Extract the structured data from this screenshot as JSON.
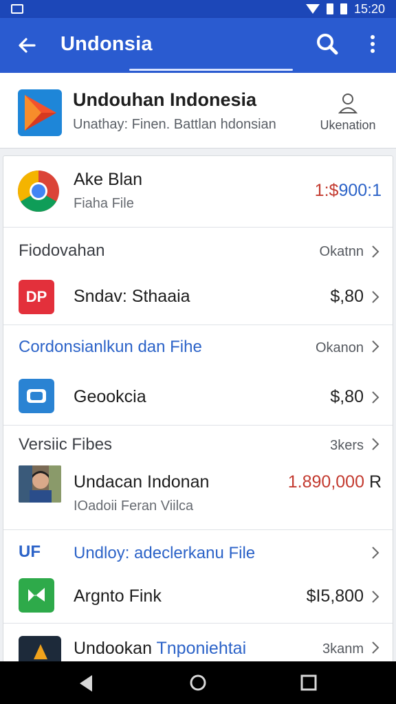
{
  "status_bar": {
    "time": "15:20"
  },
  "app_bar": {
    "title": "Undonsia"
  },
  "header": {
    "title": "Undouhan Indonesia",
    "subtitle": "Unathay: Finen. Battlan hdonsian",
    "account_label": "Ukenation"
  },
  "rows": {
    "app1": {
      "label": "Ake Blan",
      "sub": "Fiaha File",
      "value_red": "1:$",
      "value_blue": "900:1"
    },
    "section1": {
      "title": "Fiodovahan",
      "right": "Okatnn"
    },
    "app2": {
      "icon_text": "DP",
      "label": "Sndav: Sthaaia",
      "value": "$,80"
    },
    "section2": {
      "title": "Cordonsianlkun dan Fihe",
      "right": "Okanon"
    },
    "app3": {
      "label": "Geookcia",
      "value": "$,80"
    },
    "section3": {
      "title": "Versiic Fibes",
      "right": "3kers"
    },
    "app4": {
      "label": "Undacan Indonan",
      "sub": "IOadoii Feran Viilca",
      "value_red": "1.890,000",
      "value_suffix": "R"
    },
    "section4": {
      "icon_text": "UF",
      "title": "Undloy: adeclerkanu File"
    },
    "app5": {
      "label": "Argnto Fink",
      "value": "$I5,800"
    },
    "app6": {
      "label_a": "Undookan",
      "label_b": "Tnponiehtai",
      "right": "3kanm"
    }
  },
  "colors": {
    "app_bar": "#2a5bd0",
    "status_bar": "#1c47b8",
    "accent_blue": "#2c63c8",
    "price_red": "#c33a2f"
  },
  "icons": {
    "back": "arrow-left-icon",
    "search": "search-icon",
    "more": "more-vert-icon",
    "account": "person-icon",
    "chevron": "chevron-right-icon"
  }
}
